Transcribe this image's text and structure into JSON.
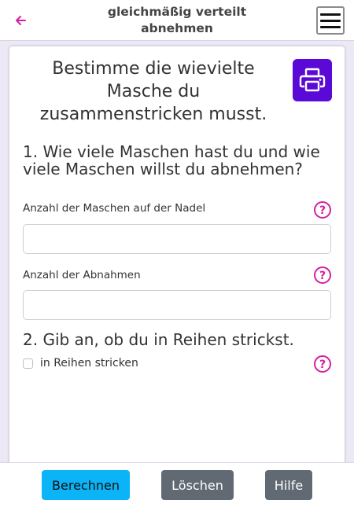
{
  "header": {
    "title": "gleichmäßig verteilt abnehmen",
    "back_icon": "arrow-left-icon",
    "menu_icon": "hamburger-menu-icon"
  },
  "card": {
    "title": "Bestimme die wievielte Masche du zusammenstricken musst.",
    "print_icon": "printer-icon",
    "section1": {
      "heading": "1. Wie viele Maschen hast du und wie viele Maschen willst du abnehmen?",
      "field1": {
        "label": "Anzahl der Maschen auf der Nadel",
        "value": "",
        "placeholder": ""
      },
      "field2": {
        "label": "Anzahl der Abnahmen",
        "value": "",
        "placeholder": ""
      }
    },
    "section2": {
      "heading": "2. Gib an, ob du in Reihen strickst.",
      "checkbox_label": "in Reihen stricken",
      "checked": false
    }
  },
  "footer": {
    "calc_label": "Berechnen",
    "clear_label": "Löschen",
    "help_label": "Hilfe"
  },
  "colors": {
    "accent": "#5a09d6",
    "help_icon": "#d61fa0",
    "back_arrow": "#d61fa0",
    "calc_button": "#0ab4f7",
    "secondary_button": "#616a73",
    "background": "#ece8f6"
  }
}
